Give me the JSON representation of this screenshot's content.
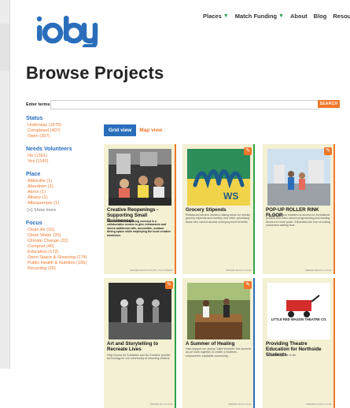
{
  "logo": {
    "text": "ioby"
  },
  "nav": {
    "items": [
      {
        "label": "Places",
        "has_caret": true
      },
      {
        "label": "Match Funding",
        "has_caret": true
      },
      {
        "label": "About",
        "has_caret": false
      },
      {
        "label": "Blog",
        "has_caret": false
      },
      {
        "label": "Resources",
        "has_caret": false
      }
    ]
  },
  "page_title": "Browse Projects",
  "search": {
    "label": "Enter terms",
    "value": "",
    "placeholder": "",
    "button": "SEARCH"
  },
  "facets": {
    "status": {
      "title": "Status",
      "options": [
        "Underway (1679)",
        "Completed (407)",
        "Open (357)"
      ]
    },
    "needs_volunteers": {
      "title": "Needs Volunteers",
      "options": [
        "No (1301)",
        "Yes (1142)"
      ]
    },
    "place": {
      "title": "Place",
      "options": [
        "Abbeville (1)",
        "Aberdeen (1)",
        "Akron (1)",
        "Albany (1)",
        "Albuquerque (1)"
      ],
      "more": "[+] Show more"
    },
    "focus": {
      "title": "Focus",
      "options": [
        "Clean Air (10)",
        "Clean Water (20)",
        "Climate Change (22)",
        "Compost (40)",
        "Education (172)",
        "Open Space & Greening (174)",
        "Public Health & Nutrition (105)",
        "Recycling (26)"
      ]
    }
  },
  "view": {
    "grid": "Grid view",
    "map": "Map view"
  },
  "cards": [
    {
      "title": "Creative Reopenings - Supporting Small Businesses",
      "desc": "The Creative Reopening concept is a collaborative means to give restaurants and stores additional safe, accessible, outdoor dining space while employing the local creative workforce.",
      "foot": "NEEDED $4,034 FOLLOW | VOLUNTEERS",
      "stripe": "#f1772b",
      "badge": false
    },
    {
      "title": "Grocery Stipends",
      "desc": "Restaurant service workers raising funds for weekly grocery stipends and monthly rent relief, prioritizing those who cannot access unemployment benefits.",
      "foot": "NEEDED $2,029 of GOAL",
      "stripe": "#2ca24a",
      "badge": true
    },
    {
      "title": "POP-UP ROLLER RINK FLOOR",
      "desc": "This pop-up floor enables us access to recreational centers and other school programming and funding. Access to more youth. Eliminates the fear of cutting costumers waiting floor.",
      "foot": "NEEDED $81,404 of GOAL",
      "stripe": "#f1772b",
      "badge": true
    },
    {
      "title": "Art and Storytelling to Recreate Lives",
      "desc": "Help Donna for Subsidies and No Creative provide technology for our community of returning citizens.",
      "foot": "NEEDED $1,174 GOAL",
      "stripe": "#2ca24a",
      "badge": true
    },
    {
      "title": "A Summer of Healing",
      "desc": "Help support our young \"Light Workers\" this summer as we work together to create a healthier, empowered, equitable community.",
      "foot": "NEEDED $5,071 GOAL",
      "stripe": "#2a6ebb",
      "badge": true
    },
    {
      "title": "Providing Theatre Education for Northside Students",
      "desc": "Theatre brings life to life.",
      "foot": "NEEDED $1,256 of GOAL",
      "stripe": "#f1772b",
      "badge": false,
      "logo": "LITTLE RED WAGON THEATRE CO."
    }
  ],
  "colors": {
    "accent_blue": "#2a6ebb",
    "accent_orange": "#f1772b",
    "accent_green": "#2ca24a",
    "card_bg": "#f3f0d3"
  },
  "icons": {
    "nav_caret": "caret-down-icon",
    "badge": "edit-icon"
  }
}
